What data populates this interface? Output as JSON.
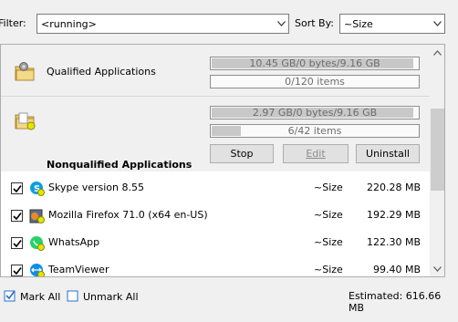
{
  "toolbar": {
    "filter_label": "Filter:",
    "filter_value": "<running>",
    "sortby_label": "Sort By:",
    "sort_value": "~Size"
  },
  "groups": [
    {
      "label": "Qualified Applications",
      "size_text": "10.45 GB/0 bytes/9.16 GB",
      "size_fill": 0.98,
      "items_text": "0/120 items",
      "items_fill": 0.0
    },
    {
      "label": "Nonqualified Applications",
      "size_text": "2.97 GB/0 bytes/9.16 GB",
      "size_fill": 0.98,
      "items_text": "6/42 items",
      "items_fill": 0.14
    }
  ],
  "actions": {
    "stop": "Stop",
    "edit": "Edit",
    "uninstall": "Uninstall"
  },
  "apps": [
    {
      "name": "Skype version 8.55",
      "sort": "~Size",
      "size": "220.28 MB",
      "checked": true,
      "icon": "skype-icon"
    },
    {
      "name": "Mozilla Firefox 71.0 (x64 en-US)",
      "sort": "~Size",
      "size": "192.29 MB",
      "checked": true,
      "icon": "firefox-icon"
    },
    {
      "name": "WhatsApp",
      "sort": "~Size",
      "size": "122.30 MB",
      "checked": true,
      "icon": "whatsapp-icon"
    },
    {
      "name": "TeamViewer",
      "sort": "~Size",
      "size": "99.40 MB",
      "checked": true,
      "icon": "teamviewer-icon"
    }
  ],
  "footer": {
    "mark_all": "Mark All",
    "unmark_all": "Unmark All",
    "estimated": "Estimated: 616.66 MB"
  }
}
